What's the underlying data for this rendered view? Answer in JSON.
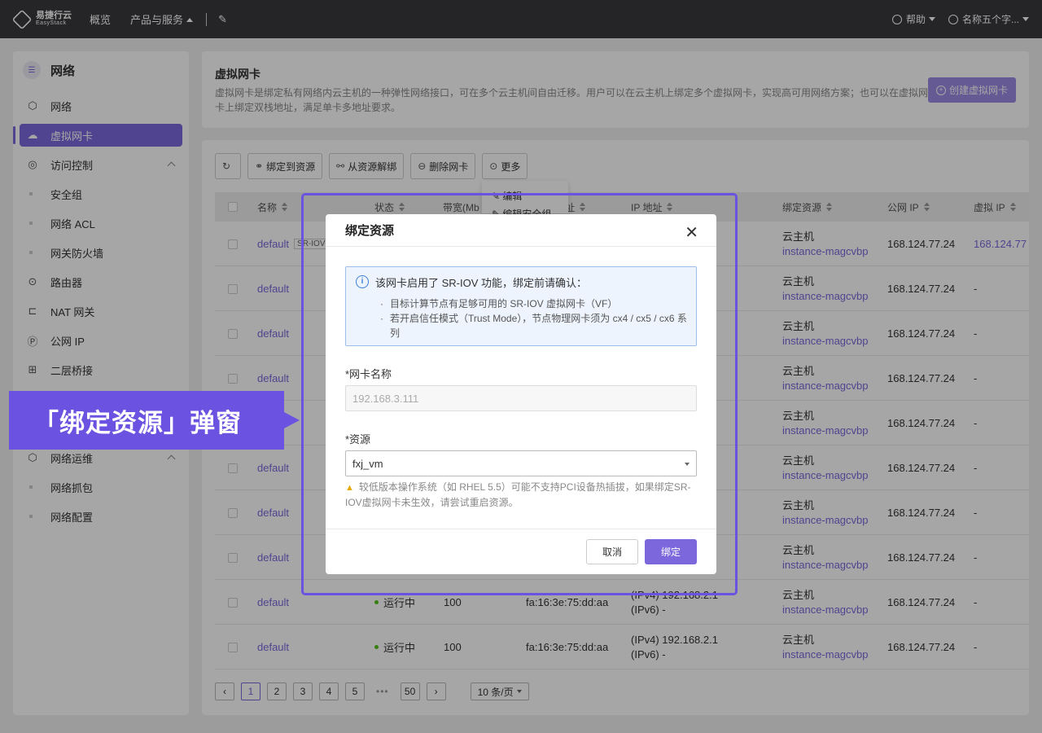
{
  "topbar": {
    "logo_cn": "易捷行云",
    "logo_en": "EasyStack",
    "nav": [
      "概览",
      "产品与服务"
    ],
    "help": "帮助",
    "user": "名称五个字..."
  },
  "sidebar": {
    "title": "网络",
    "items": [
      {
        "label": "网络",
        "icon": "network-icon",
        "sub": false,
        "active": false
      },
      {
        "label": "虚拟网卡",
        "icon": "nic-icon",
        "sub": false,
        "active": true
      },
      {
        "label": "访问控制",
        "icon": "shield-icon",
        "sub": false,
        "active": false,
        "expand": true
      },
      {
        "label": "安全组",
        "sub": true
      },
      {
        "label": "网络 ACL",
        "sub": true
      },
      {
        "label": "网关防火墙",
        "sub": true
      },
      {
        "label": "路由器",
        "icon": "router-icon",
        "sub": false
      },
      {
        "label": "NAT 网关",
        "icon": "nat-icon",
        "sub": false
      },
      {
        "label": "公网 IP",
        "icon": "ip-icon",
        "sub": false
      },
      {
        "label": "二层桥接",
        "icon": "bridge-icon",
        "sub": false
      },
      {
        "label": "网络运维",
        "icon": "ops-icon",
        "sub": false,
        "expand": true
      },
      {
        "label": "网络抓包",
        "sub": true
      },
      {
        "label": "网络配置",
        "sub": true
      }
    ]
  },
  "header": {
    "title": "虚拟网卡",
    "desc": "虚拟网卡是绑定私有网络内云主机的一种弹性网络接口，可在多个云主机间自由迁移。用户可以在云主机上绑定多个虚拟网卡，实现高可用网络方案；也可以在虚拟网卡上绑定双栈地址，满足单卡多地址要求。",
    "create_label": "创建虚拟网卡"
  },
  "toolbar": {
    "bind": "绑定到资源",
    "unbind": "从资源解绑",
    "delete": "删除网卡",
    "more": "更多"
  },
  "more_menu": [
    "编辑",
    "编辑安全组"
  ],
  "table": {
    "columns": [
      "名称",
      "状态",
      "带宽(Mb",
      "址",
      "IP 地址",
      "绑定资源",
      "公网 IP",
      "虚拟 IP"
    ],
    "rows": [
      {
        "name": "default",
        "tag": "SR-IOV",
        "status": "",
        "bw": "",
        "mac": "",
        "ip1": "",
        "ip2": "",
        "res1": "云主机",
        "res2": "instance-magcvbp",
        "pub": "168.124.77.24",
        "vip": "168.124.77"
      },
      {
        "name": "default",
        "res1": "云主机",
        "res2": "instance-magcvbp",
        "pub": "168.124.77.24",
        "vip": "-"
      },
      {
        "name": "default",
        "res1": "云主机",
        "res2": "instance-magcvbp",
        "pub": "168.124.77.24",
        "vip": "-"
      },
      {
        "name": "default",
        "res1": "云主机",
        "res2": "instance-magcvbp",
        "pub": "168.124.77.24",
        "vip": "-"
      },
      {
        "name": "",
        "res1": "云主机",
        "res2": "instance-magcvbp",
        "pub": "168.124.77.24",
        "vip": "-"
      },
      {
        "name": "default",
        "res1": "云主机",
        "res2": "instance-magcvbp",
        "pub": "168.124.77.24",
        "vip": "-"
      },
      {
        "name": "default",
        "res1": "云主机",
        "res2": "instance-magcvbp",
        "pub": "168.124.77.24",
        "vip": "-"
      },
      {
        "name": "default",
        "res1": "云主机",
        "res2": "instance-magcvbp",
        "pub": "168.124.77.24",
        "vip": "-"
      },
      {
        "name": "default",
        "status": "运行中",
        "bw": "100",
        "mac": "fa:16:3e:75:dd:aa",
        "ip1": "(IPv4) 192.168.2.1",
        "ip2": "(IPv6) -",
        "res1": "云主机",
        "res2": "instance-magcvbp",
        "pub": "168.124.77.24",
        "vip": "-"
      },
      {
        "name": "default",
        "status": "运行中",
        "bw": "100",
        "mac": "fa:16:3e:75:dd:aa",
        "ip1": "(IPv4) 192.168.2.1",
        "ip2": "(IPv6) -",
        "res1": "云主机",
        "res2": "instance-magcvbp",
        "pub": "168.124.77.24",
        "vip": "-"
      }
    ]
  },
  "pager": {
    "pages": [
      "1",
      "2",
      "3",
      "4",
      "5",
      "50"
    ],
    "ellipsis": "•••",
    "size": "10 条/页"
  },
  "modal": {
    "title": "绑定资源",
    "alert_title": "该网卡启用了 SR-IOV 功能，绑定前请确认：",
    "alert_items": [
      "目标计算节点有足够可用的 SR-IOV 虚拟网卡（VF）",
      "若开启信任模式（Trust Mode），节点物理网卡须为 cx4 / cx5 / cx6 系列"
    ],
    "nic_label": "*网卡名称",
    "nic_value": "192.168.3.111",
    "res_label": "*资源",
    "res_value": "fxj_vm",
    "warning": "较低版本操作系统（如 RHEL 5.5）可能不支持PCI设备热插拔，如果绑定SR-IOV虚拟网卡未生效，请尝试重启资源。",
    "cancel": "取消",
    "ok": "绑定"
  },
  "callout": "「绑定资源」弹窗",
  "colors": {
    "accent": "#7c68dc",
    "highlight": "#6b52e0"
  }
}
